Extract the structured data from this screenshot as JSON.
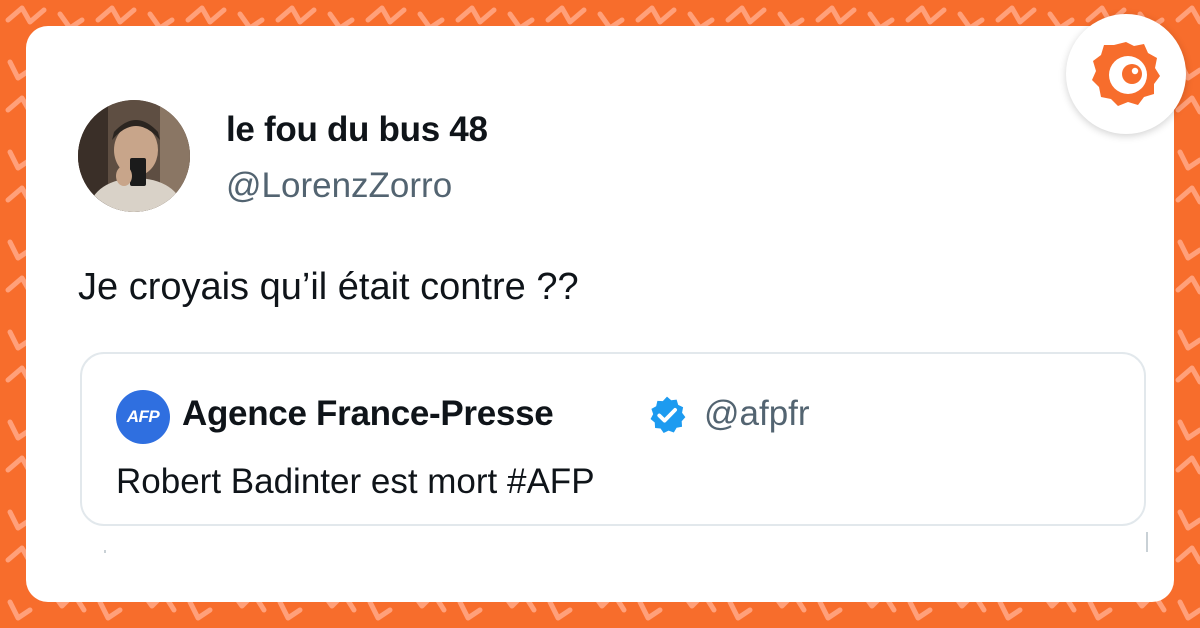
{
  "colors": {
    "background": "#f76d2c",
    "pattern": "#ffa07a",
    "card": "#ffffff",
    "text": "#0f1419",
    "secondary_text": "#536471",
    "afp_blue": "#2f6fe0",
    "verified_blue": "#1d9bf0",
    "brand_orange": "#f76d2c"
  },
  "tweet": {
    "display_name": "le fou du bus 48",
    "handle": "@LorenzZorro",
    "text": "Je croyais qu’il était contre ??"
  },
  "quoted_tweet": {
    "logo_text": "AFP",
    "display_name": "Agence France-Presse",
    "verified_icon": "verified-badge-icon",
    "handle": "@afpfr",
    "text": "Robert Badinter est mort #AFP"
  },
  "brand": {
    "icon": "brand-logo-icon"
  }
}
